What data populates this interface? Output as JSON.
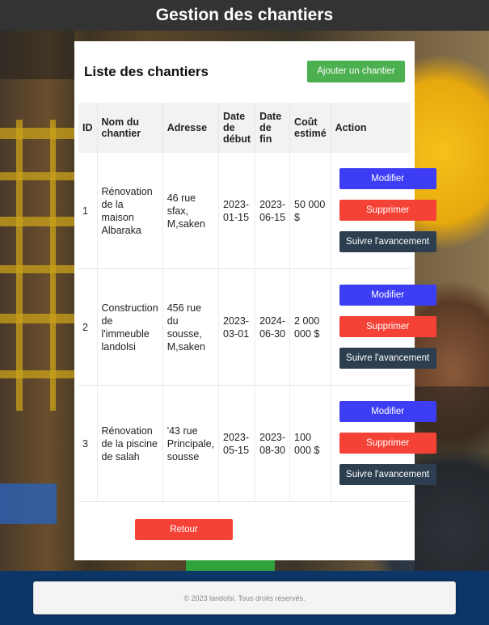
{
  "header": {
    "title": "Gestion des chantiers"
  },
  "card": {
    "title": "Liste des chantiers",
    "add_button": "Ajouter un chantier",
    "back_button": "Retour"
  },
  "table": {
    "headers": {
      "id": "ID",
      "nom": "Nom du chantier",
      "adresse": "Adresse",
      "debut": "Date de début",
      "fin": "Date de fin",
      "cout": "Coût estimé",
      "action": "Action"
    },
    "rows": [
      {
        "id": "1",
        "nom": "Rénovation de la maison Albaraka",
        "adresse": "46 rue sfax, M,saken",
        "debut": "2023-01-15",
        "fin": "2023-06-15",
        "cout": "50 000 $"
      },
      {
        "id": "2",
        "nom": "Construction de l'immeuble landolsi",
        "adresse": "456 rue du sousse, M,saken",
        "debut": "2023-03-01",
        "fin": "2024-06-30",
        "cout": "2 000 000 $"
      },
      {
        "id": "3",
        "nom": "Rénovation de la piscine de salah",
        "adresse": "'43 rue Principale, sousse",
        "debut": "2023-05-15",
        "fin": "2023-08-30",
        "cout": "100 000 $"
      }
    ],
    "actions": {
      "modifier": "Modifier",
      "supprimer": "Supprimer",
      "suivre": "Suivre l'avancement"
    }
  },
  "footer": {
    "text": "© 2023 landolsi. Tous droits réservés."
  },
  "colors": {
    "header_bg": "#333333",
    "add_button": "#4caf50",
    "modifier_button": "#3d3df5",
    "supprimer_button": "#f44336",
    "suivre_button": "#2c3e50",
    "footer_band": "#0d3668"
  }
}
